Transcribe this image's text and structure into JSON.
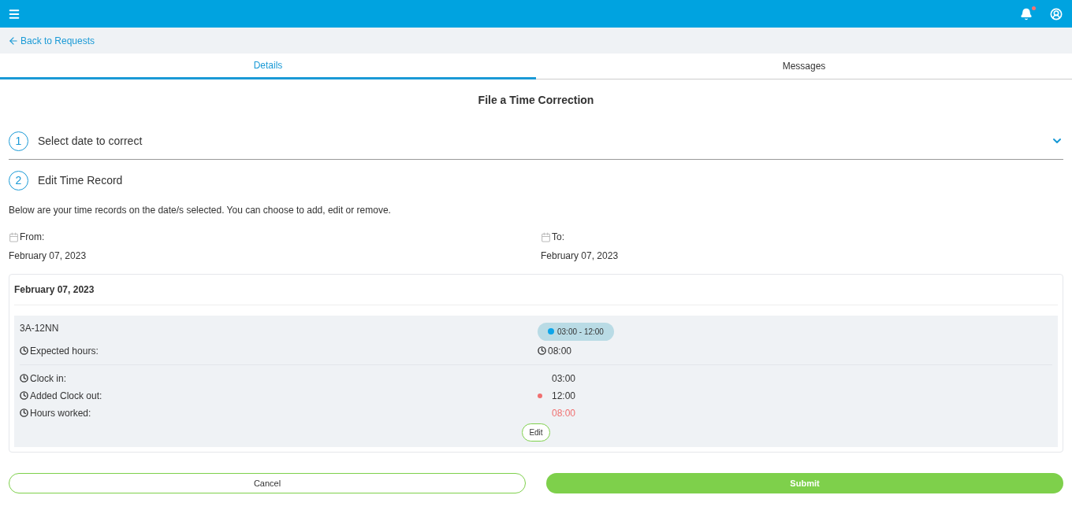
{
  "topbar": {
    "notification_dot": true
  },
  "back_link": "Back to Requests",
  "tabs": [
    {
      "label": "Details",
      "selected": true
    },
    {
      "label": "Messages",
      "selected": false
    }
  ],
  "title": "File a Time Correction",
  "steps": [
    {
      "number": "1",
      "label": "Select date to correct",
      "expanded": false
    },
    {
      "number": "2",
      "label": "Edit Time Record",
      "expanded": true
    }
  ],
  "description": "Below are your time records on the date/s selected. You can choose to add, edit or remove.",
  "from": {
    "label": "From:",
    "value": "February 07, 2023"
  },
  "to": {
    "label": "To:",
    "value": "February 07, 2023"
  },
  "record": {
    "date": "February 07, 2023",
    "shift": "3A-12NN",
    "schedule": "03:00 - 12:00",
    "expected_label": "Expected hours:",
    "expected_value": "08:00",
    "entries": [
      {
        "label": "Clock in:",
        "value": "03:00",
        "added": false,
        "warning": false
      },
      {
        "label": "Added Clock out:",
        "value": "12:00",
        "added": true,
        "warning": false
      },
      {
        "label": "Hours worked:",
        "value": "08:00",
        "added": false,
        "warning": true
      }
    ],
    "edit": "Edit"
  },
  "buttons": {
    "cancel": "Cancel",
    "submit": "Submit"
  }
}
